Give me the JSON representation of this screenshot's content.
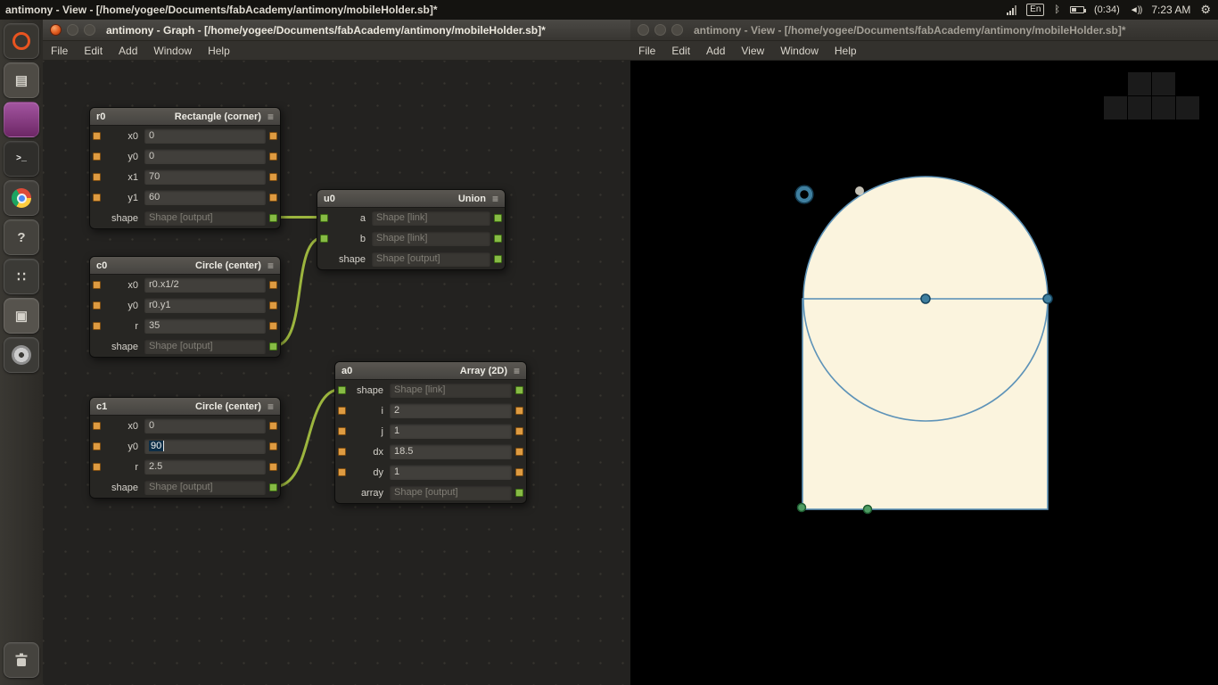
{
  "top_bar": {
    "title": "antimony - View - [/home/yogee/Documents/fabAcademy/antimony/mobileHolder.sb]*",
    "keyboard_layout": "En",
    "bluetooth_glyph": "ᛒ",
    "battery_time": "(0:34)",
    "volume_glyph": "◄))",
    "clock": "7:23 AM",
    "gear_glyph": "⚙"
  },
  "launcher": {
    "items": [
      {
        "name": "ubuntu-dash",
        "glyph": "",
        "bg": "#383631"
      },
      {
        "name": "files",
        "glyph": "▤",
        "bg": "#4e4b45"
      },
      {
        "name": "software-center",
        "glyph": "",
        "bg": "linear-gradient(#a355a0,#6d2766)"
      },
      {
        "name": "terminal",
        "glyph": ">_",
        "bg": "#2f2e2b"
      },
      {
        "name": "chrome",
        "glyph": "",
        "bg": "#403e3a"
      },
      {
        "name": "help",
        "glyph": "?",
        "bg": "#44423d"
      },
      {
        "name": "calculator",
        "glyph": "∷",
        "bg": "#3b3a36"
      },
      {
        "name": "text-editor",
        "glyph": "▣",
        "bg": "#56534d"
      },
      {
        "name": "disc-burner",
        "glyph": "",
        "bg": "#3c3b37"
      },
      {
        "name": "trash",
        "glyph": "",
        "bg": "#45433e"
      }
    ]
  },
  "graph_window": {
    "title": "antimony - Graph - [/home/yogee/Documents/fabAcademy/antimony/mobileHolder.sb]*",
    "menus": [
      "File",
      "Edit",
      "Add",
      "Window",
      "Help"
    ],
    "grip_glyph": "≡",
    "nodes": {
      "r0": {
        "id": "r0",
        "type": "Rectangle (corner)",
        "rows": [
          {
            "label": "x0",
            "value": "0"
          },
          {
            "label": "y0",
            "value": "0"
          },
          {
            "label": "x1",
            "value": "70"
          },
          {
            "label": "y1",
            "value": "60"
          }
        ],
        "output": {
          "label": "shape",
          "value": "Shape [output]"
        }
      },
      "c0": {
        "id": "c0",
        "type": "Circle (center)",
        "rows": [
          {
            "label": "x0",
            "value": "r0.x1/2"
          },
          {
            "label": "y0",
            "value": "r0.y1"
          },
          {
            "label": "r",
            "value": "35"
          }
        ],
        "output": {
          "label": "shape",
          "value": "Shape [output]"
        }
      },
      "u0": {
        "id": "u0",
        "type": "Union",
        "rows": [
          {
            "label": "a",
            "value": "Shape [link]"
          },
          {
            "label": "b",
            "value": "Shape [link]"
          }
        ],
        "output": {
          "label": "shape",
          "value": "Shape [output]"
        }
      },
      "c1": {
        "id": "c1",
        "type": "Circle (center)",
        "rows": [
          {
            "label": "x0",
            "value": "0"
          },
          {
            "label": "y0",
            "value": "90"
          },
          {
            "label": "r",
            "value": "2.5"
          }
        ],
        "output": {
          "label": "shape",
          "value": "Shape [output]"
        }
      },
      "a0": {
        "id": "a0",
        "type": "Array (2D)",
        "link_row": {
          "label": "shape",
          "value": "Shape [link]"
        },
        "rows": [
          {
            "label": "i",
            "value": "2"
          },
          {
            "label": "j",
            "value": "1"
          },
          {
            "label": "dx",
            "value": "18.5"
          },
          {
            "label": "dy",
            "value": "1"
          }
        ],
        "output": {
          "label": "array",
          "value": "Shape [output]"
        }
      }
    }
  },
  "view_window": {
    "title": "antimony - View - [/home/yogee/Documents/fabAcademy/antimony/mobileHolder.sb]*",
    "menus": [
      "File",
      "Edit",
      "Add",
      "View",
      "Window",
      "Help"
    ],
    "colors": {
      "shape_fill": "#fbf4de",
      "shape_stroke": "#5e93b8",
      "handle_fill": "#3f7f9f",
      "handle_stroke": "#16455f",
      "green_handle_fill": "#4f9d63",
      "green_handle_stroke": "#1d5c31",
      "widget_square": "#1b1b1b"
    }
  }
}
